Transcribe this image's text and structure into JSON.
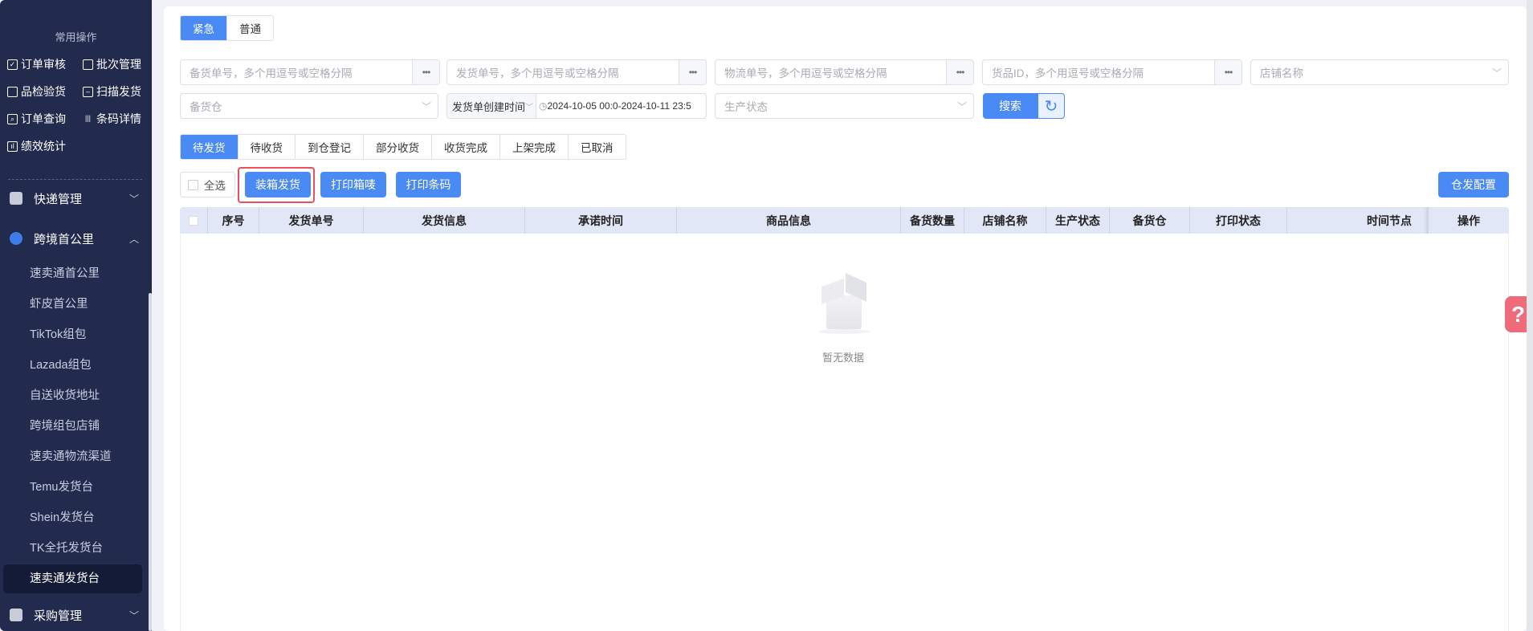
{
  "sidebar": {
    "section_title": "常用操作",
    "quick": [
      {
        "label": "订单审核",
        "icon": "check-square-icon"
      },
      {
        "label": "批次管理",
        "icon": "batch-icon"
      },
      {
        "label": "品检验货",
        "icon": "inspect-icon"
      },
      {
        "label": "扫描发货",
        "icon": "scan-icon"
      },
      {
        "label": "订单查询",
        "icon": "search-doc-icon"
      },
      {
        "label": "条码详情",
        "icon": "barcode-icon"
      },
      {
        "label": "绩效统计",
        "icon": "chart-icon"
      }
    ],
    "groups": {
      "express": "快递管理",
      "crossborder": "跨境首公里",
      "purchase": "采购管理"
    },
    "sub_items": [
      "速卖通首公里",
      "虾皮首公里",
      "TikTok组包",
      "Lazada组包",
      "自送收货地址",
      "跨境组包店铺",
      "速卖通物流渠道",
      "Temu发货台",
      "Shein发货台",
      "TK全托发货台",
      "速卖通发货台"
    ]
  },
  "priority_tabs": [
    "紧急",
    "普通"
  ],
  "filters": {
    "stock_no": "备货单号，多个用逗号或空格分隔",
    "ship_no": "发货单号，多个用逗号或空格分隔",
    "logistics_no": "物流单号，多个用逗号或空格分隔",
    "goods_id": "货品ID，多个用逗号或空格分隔",
    "shop": "店铺名称",
    "warehouse": "备货仓",
    "date_type": "发货单创建时间",
    "date_range": "2024-10-05 00:0-2024-10-11 23:5",
    "production": "生产状态",
    "search": "搜索"
  },
  "status_tabs": [
    "待发货",
    "待收货",
    "到仓登记",
    "部分收货",
    "收货完成",
    "上架完成",
    "已取消"
  ],
  "actions": {
    "select_all": "全选",
    "pack_ship": "装箱发货",
    "print_box": "打印箱唛",
    "print_barcode": "打印条码",
    "warehouse_config": "仓发配置"
  },
  "table": {
    "columns": [
      "序号",
      "发货单号",
      "发货信息",
      "承诺时间",
      "商品信息",
      "备货数量",
      "店铺名称",
      "生产状态",
      "备货仓",
      "打印状态",
      "时间节点",
      "操作"
    ],
    "empty": "暂无数据"
  },
  "help": "?"
}
